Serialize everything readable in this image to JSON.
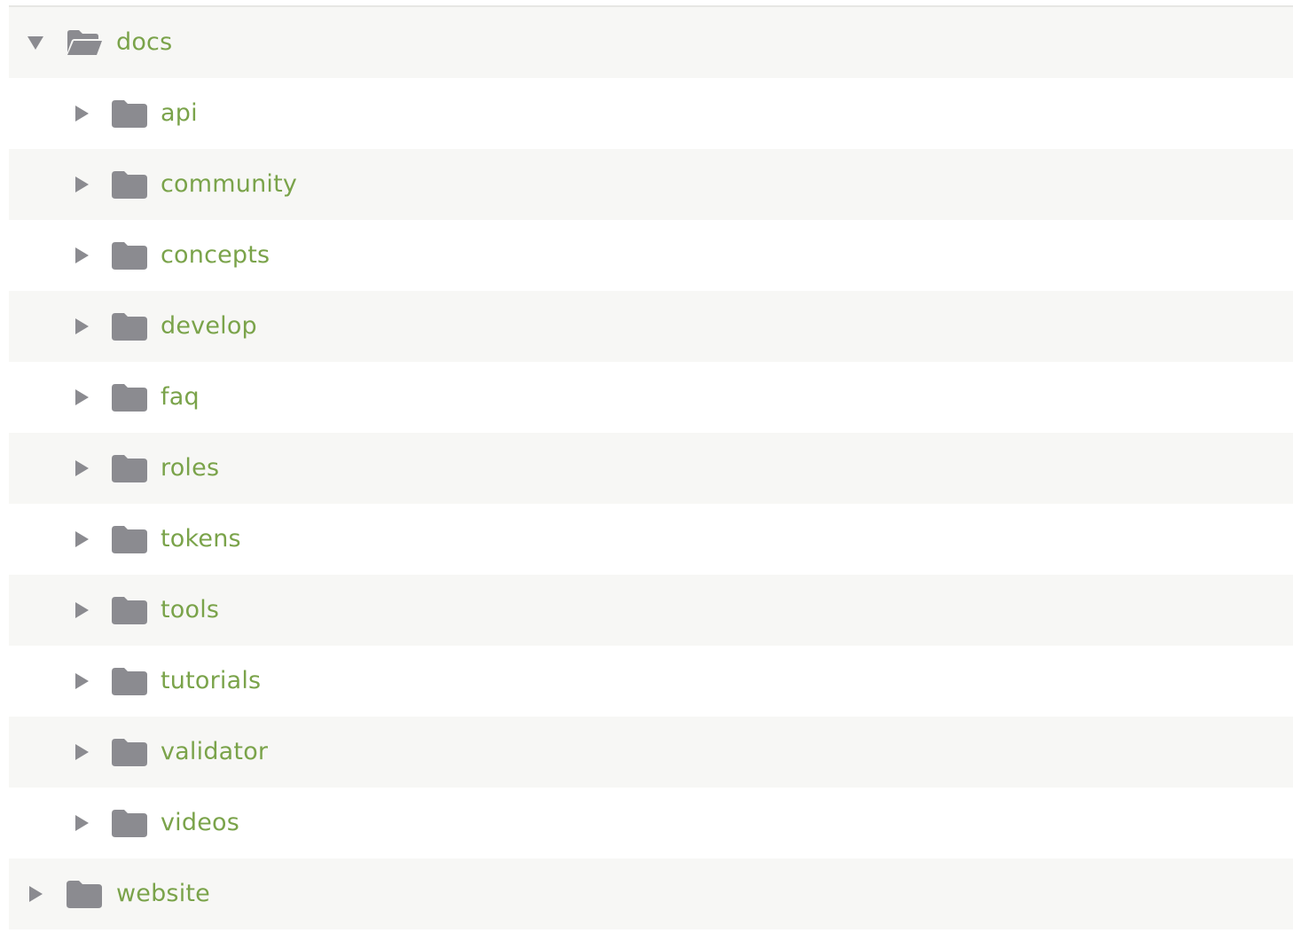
{
  "colors": {
    "link": "#7aa34a",
    "icon": "#8b8b90",
    "row_shade": "#f7f7f5"
  },
  "tree": {
    "root": {
      "label": "docs",
      "state": "expanded",
      "icon": "folder-open-icon",
      "toggle_icon": "triangle-down-icon"
    },
    "children": [
      {
        "label": "api",
        "state": "collapsed",
        "icon": "folder-icon",
        "toggle_icon": "triangle-right-icon"
      },
      {
        "label": "community",
        "state": "collapsed",
        "icon": "folder-icon",
        "toggle_icon": "triangle-right-icon"
      },
      {
        "label": "concepts",
        "state": "collapsed",
        "icon": "folder-icon",
        "toggle_icon": "triangle-right-icon"
      },
      {
        "label": "develop",
        "state": "collapsed",
        "icon": "folder-icon",
        "toggle_icon": "triangle-right-icon"
      },
      {
        "label": "faq",
        "state": "collapsed",
        "icon": "folder-icon",
        "toggle_icon": "triangle-right-icon"
      },
      {
        "label": "roles",
        "state": "collapsed",
        "icon": "folder-icon",
        "toggle_icon": "triangle-right-icon"
      },
      {
        "label": "tokens",
        "state": "collapsed",
        "icon": "folder-icon",
        "toggle_icon": "triangle-right-icon"
      },
      {
        "label": "tools",
        "state": "collapsed",
        "icon": "folder-icon",
        "toggle_icon": "triangle-right-icon"
      },
      {
        "label": "tutorials",
        "state": "collapsed",
        "icon": "folder-icon",
        "toggle_icon": "triangle-right-icon"
      },
      {
        "label": "validator",
        "state": "collapsed",
        "icon": "folder-icon",
        "toggle_icon": "triangle-right-icon"
      },
      {
        "label": "videos",
        "state": "collapsed",
        "icon": "folder-icon",
        "toggle_icon": "triangle-right-icon"
      }
    ],
    "sibling": {
      "label": "website",
      "state": "collapsed",
      "icon": "folder-icon",
      "toggle_icon": "triangle-right-icon"
    }
  }
}
